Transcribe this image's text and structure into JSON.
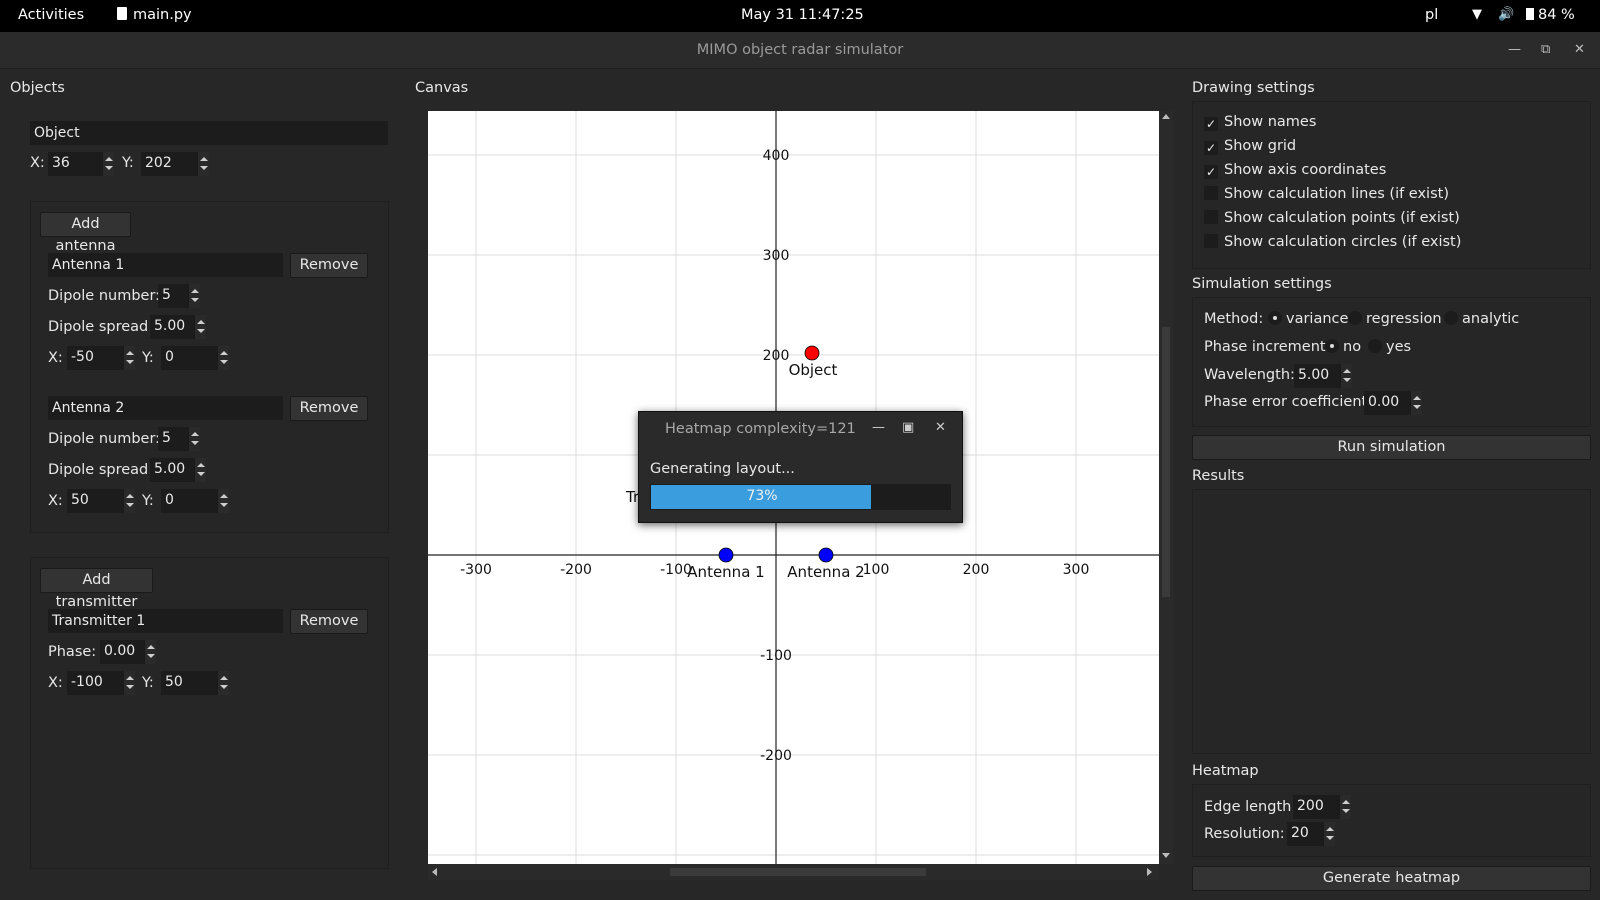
{
  "topbar": {
    "activities": "Activities",
    "app": "main.py",
    "clock": "May 31  11:47:25",
    "lang": "pl",
    "battery": "84 %"
  },
  "window": {
    "title": "MIMO object radar simulator"
  },
  "objects": {
    "header": "Objects",
    "object_name": "Object",
    "x_label": "X:",
    "x": "36",
    "y_label": "Y:",
    "y": "202",
    "add_antenna": "Add antenna",
    "antennas": [
      {
        "name": "Antenna 1",
        "remove": "Remove",
        "dipole_number_label": "Dipole number:",
        "dipole_number": "5",
        "dipole_spread_label": "Dipole spread:",
        "dipole_spread": "5.00",
        "x_label": "X:",
        "x": "-50",
        "y_label": "Y:",
        "y": "0"
      },
      {
        "name": "Antenna 2",
        "remove": "Remove",
        "dipole_number_label": "Dipole number:",
        "dipole_number": "5",
        "dipole_spread_label": "Dipole spread:",
        "dipole_spread": "5.00",
        "x_label": "X:",
        "x": "50",
        "y_label": "Y:",
        "y": "0"
      }
    ],
    "add_transmitter": "Add transmitter",
    "transmitters": [
      {
        "name": "Transmitter 1",
        "remove": "Remove",
        "phase_label": "Phase:",
        "phase": "0.00",
        "x_label": "X:",
        "x": "-100",
        "y_label": "Y:",
        "y": "50"
      }
    ]
  },
  "canvas": {
    "header": "Canvas",
    "x_ticks": [
      -300,
      -200,
      -100,
      100,
      200,
      300
    ],
    "y_ticks": [
      400,
      300,
      200,
      -100,
      -200
    ],
    "points": [
      {
        "label": "Object",
        "x": 36,
        "y": 202,
        "color": "#ff0000"
      },
      {
        "label": "Antenna 1",
        "x": -50,
        "y": 0,
        "color": "#0000ff"
      },
      {
        "label": "Antenna 2",
        "x": 50,
        "y": 0,
        "color": "#0000ff"
      }
    ],
    "transmitter_label": "Transmitter 1"
  },
  "drawing": {
    "header": "Drawing settings",
    "options": [
      {
        "label": "Show names",
        "checked": true
      },
      {
        "label": "Show grid",
        "checked": true
      },
      {
        "label": "Show axis coordinates",
        "checked": true
      },
      {
        "label": "Show calculation lines (if exist)",
        "checked": false
      },
      {
        "label": "Show calculation points (if exist)",
        "checked": false
      },
      {
        "label": "Show calculation circles (if exist)",
        "checked": false
      }
    ]
  },
  "simulation": {
    "header": "Simulation settings",
    "method_label": "Method:",
    "methods": [
      "variance",
      "regression",
      "analytic"
    ],
    "method_selected": 0,
    "phase_inc_label": "Phase increment:",
    "phase_inc_options": [
      "no",
      "yes"
    ],
    "phase_inc_selected": 0,
    "wavelength_label": "Wavelength:",
    "wavelength": "5.00",
    "phase_err_label": "Phase error coefficient:",
    "phase_err": "0.00",
    "run": "Run simulation"
  },
  "results": {
    "header": "Results"
  },
  "heatmap": {
    "header": "Heatmap",
    "edge_label": "Edge length:",
    "edge": "200",
    "res_label": "Resolution:",
    "res": "20",
    "generate": "Generate heatmap"
  },
  "dialog": {
    "title": "Heatmap complexity=121",
    "message": "Generating layout...",
    "progress": 0.73,
    "progress_text": "73%"
  }
}
